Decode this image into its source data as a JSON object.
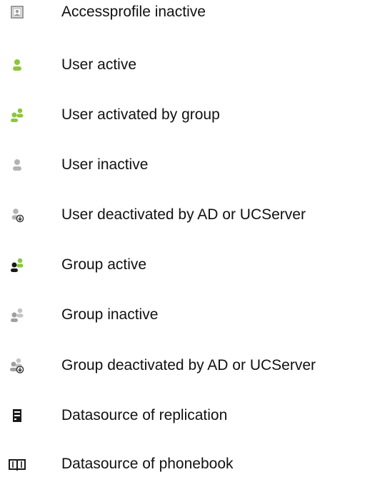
{
  "legend": {
    "items": [
      {
        "icon": "accessprofile-inactive-icon",
        "label": "Accessprofile inactive"
      },
      {
        "icon": "user-active-icon",
        "label": "User active"
      },
      {
        "icon": "user-activated-by-group-icon",
        "label": "User activated by group"
      },
      {
        "icon": "user-inactive-icon",
        "label": "User inactive"
      },
      {
        "icon": "user-deactivated-icon",
        "label": "User deactivated by AD or UCServer"
      },
      {
        "icon": "group-active-icon",
        "label": "Group active"
      },
      {
        "icon": "group-inactive-icon",
        "label": "Group inactive"
      },
      {
        "icon": "group-deactivated-icon",
        "label": "Group deactivated by AD or UCServer"
      },
      {
        "icon": "datasource-replication-icon",
        "label": "Datasource of replication"
      },
      {
        "icon": "datasource-phonebook-icon",
        "label": "Datasource of phonebook"
      }
    ]
  },
  "colors": {
    "green": "#8cc63e",
    "gray": "#b3b3b3",
    "dark": "#1a1a1a",
    "text": "#111111"
  }
}
